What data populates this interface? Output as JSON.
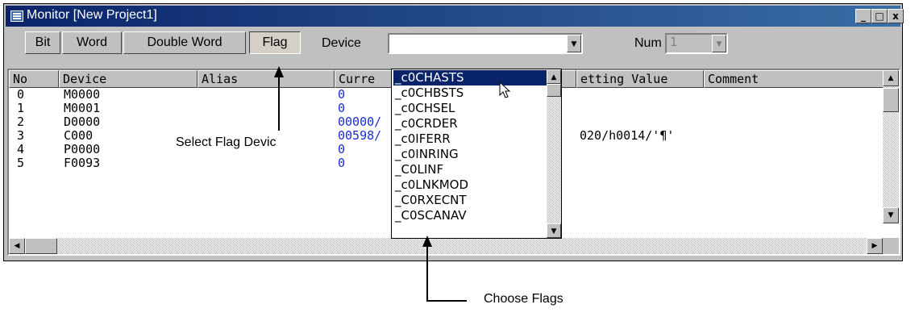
{
  "window": {
    "title": "Monitor [New Project1]",
    "min_label": "_",
    "max_label": "□",
    "close_label": "x"
  },
  "tabs": [
    {
      "label": "Bit"
    },
    {
      "label": "Word"
    },
    {
      "label": "Double Word"
    },
    {
      "label": "Flag"
    }
  ],
  "toolbar": {
    "device_label": "Device",
    "device_value": "",
    "num_label": "Num",
    "num_value": "1"
  },
  "columns": [
    "No",
    "Device",
    "Alias",
    "Curre",
    "etting Value",
    "Comment"
  ],
  "rows": [
    {
      "no": "0",
      "device": "M0000",
      "current": "0",
      "setting": ""
    },
    {
      "no": "1",
      "device": "M0001",
      "current": "0",
      "setting": ""
    },
    {
      "no": "2",
      "device": "D0000",
      "current": "00000/",
      "setting": ""
    },
    {
      "no": "3",
      "device": "C000",
      "current": "00598/",
      "setting": "020/h0014/'¶'"
    },
    {
      "no": "4",
      "device": "P0000",
      "current": "0",
      "setting": ""
    },
    {
      "no": "5",
      "device": "F0093",
      "current": "0",
      "setting": ""
    }
  ],
  "dropdown_items": [
    "_c0CHASTS",
    "_c0CHBSTS",
    "_c0CHSEL",
    "_c0CRDER",
    "_c0IFERR",
    "_c0INRING",
    "_C0LINF",
    "_c0LNKMOD",
    "_C0RXECNT",
    "_C0SCANAV"
  ],
  "annotations": {
    "select_flag": "Select Flag Devic",
    "choose_flags": "Choose Flags"
  }
}
